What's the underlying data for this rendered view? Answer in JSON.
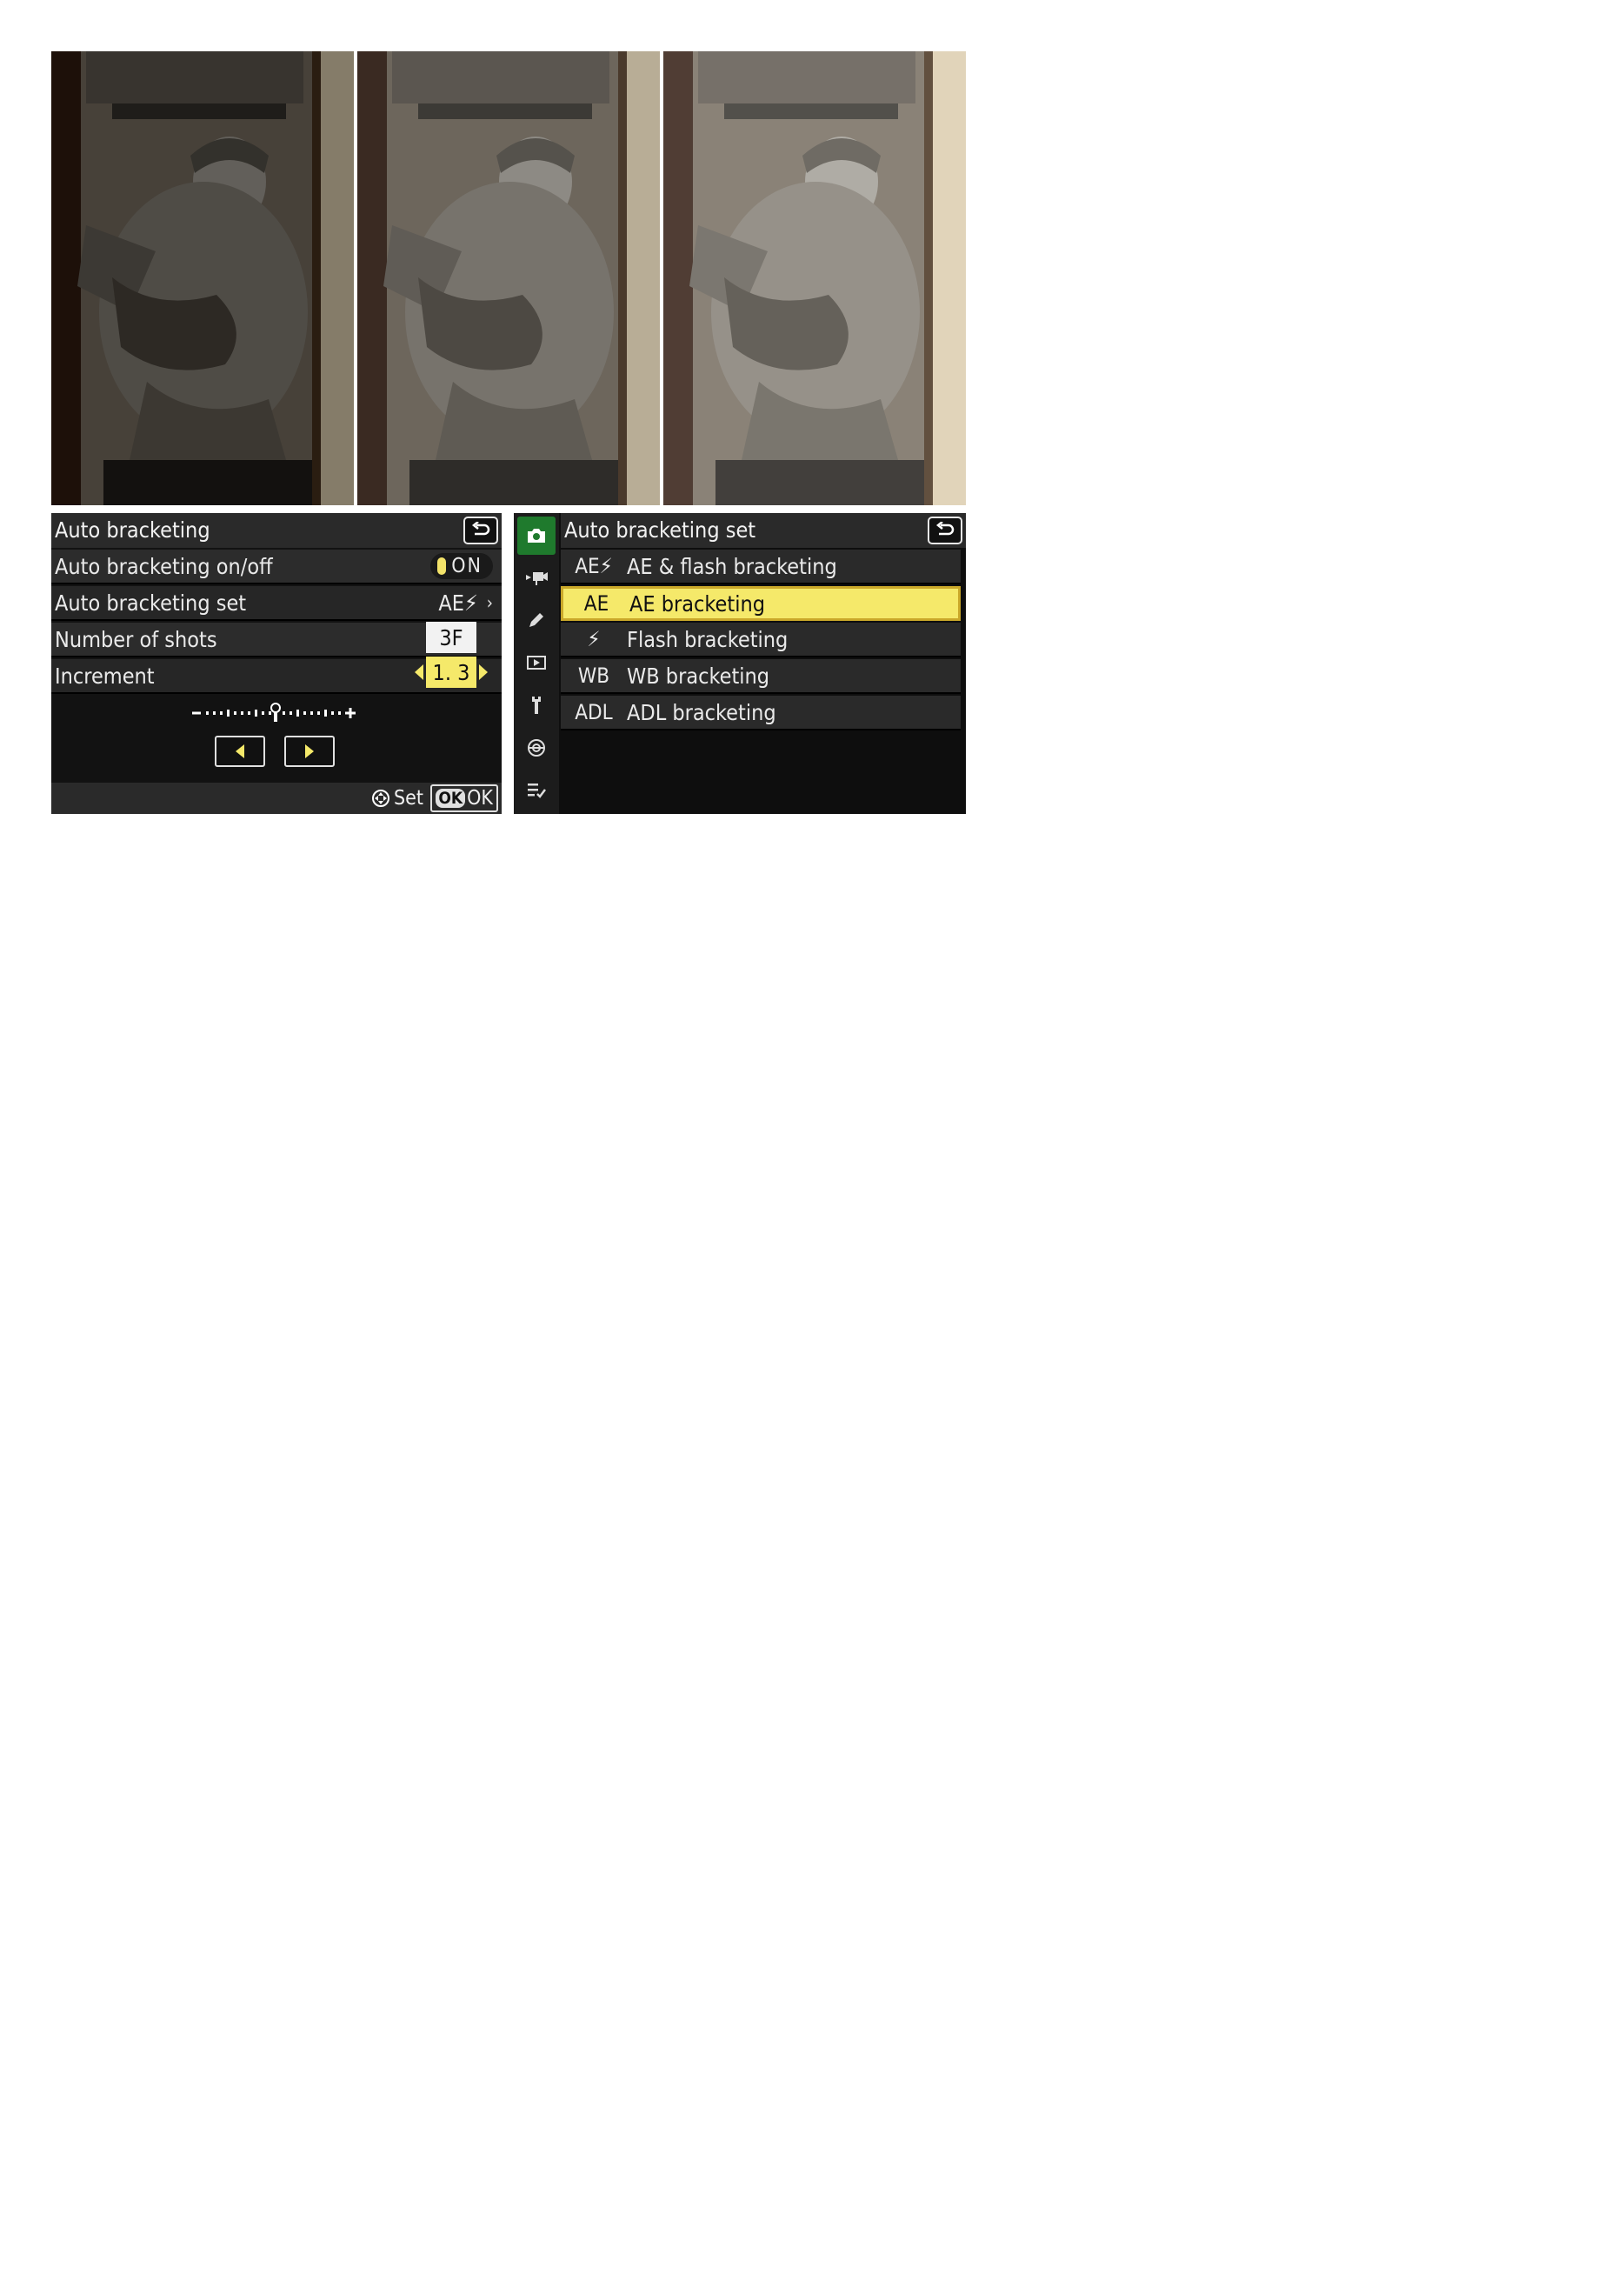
{
  "photos": {
    "panels": [
      {
        "label": "underexposed"
      },
      {
        "label": "normal"
      },
      {
        "label": "overexposed"
      }
    ]
  },
  "left_screen": {
    "title": "Auto bracketing",
    "rows": [
      {
        "label": "Auto bracketing on/off",
        "value": "ON"
      },
      {
        "label": "Auto bracketing set",
        "value": "AE⚡"
      },
      {
        "label": "Number of shots",
        "value": "3F"
      },
      {
        "label": "Increment",
        "value": "1. 3"
      }
    ],
    "footer": {
      "set_label": "Set",
      "ok_badge": "OK",
      "ok_label": "OK"
    }
  },
  "right_screen": {
    "title": "Auto bracketing set",
    "options": [
      {
        "code": "AE⚡",
        "label": "AE & flash bracketing",
        "selected": false
      },
      {
        "code": "AE",
        "label": "AE bracketing",
        "selected": true
      },
      {
        "code": "⚡",
        "label": "Flash bracketing",
        "selected": false
      },
      {
        "code": "WB",
        "label": "WB bracketing",
        "selected": false
      },
      {
        "code": "ADL",
        "label": "ADL bracketing",
        "selected": false
      }
    ],
    "tabs": [
      "camera-icon",
      "movie-icon",
      "pencil-icon",
      "playback-icon",
      "wrench-icon",
      "network-icon",
      "my-menu-icon"
    ]
  },
  "colors": {
    "highlight": "#f5e96a",
    "active_tab": "#1f7a2d"
  }
}
